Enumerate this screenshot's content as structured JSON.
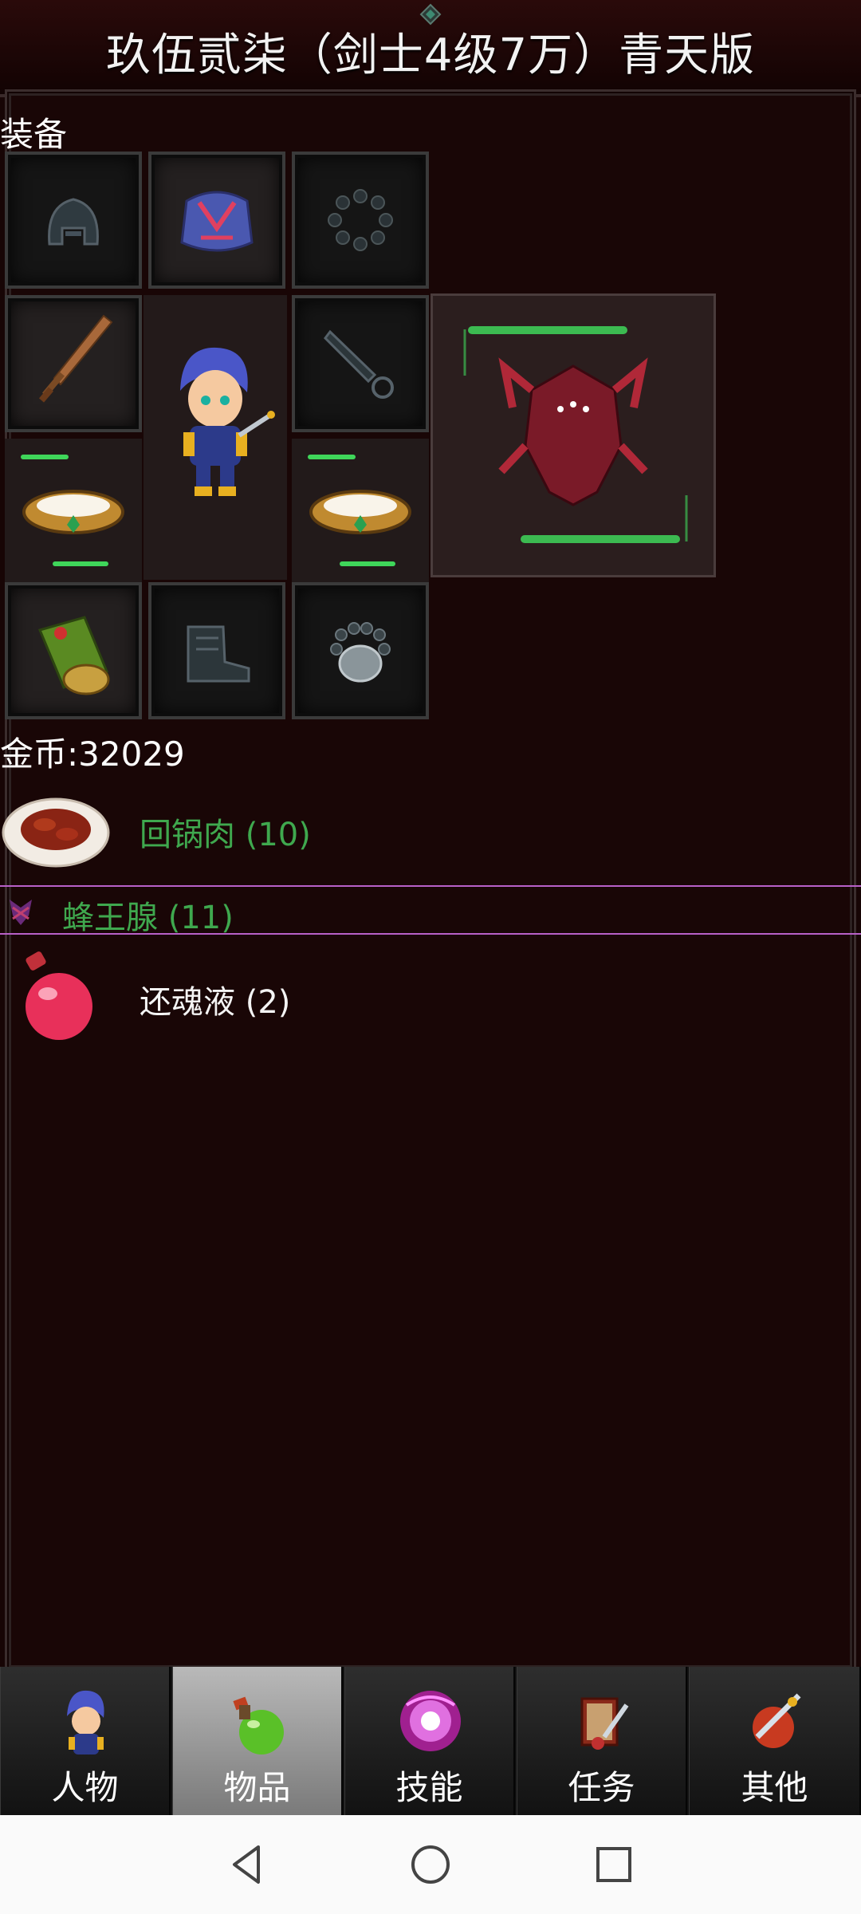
{
  "title": "玖伍贰柒（剑士4级7万）青天版",
  "equipment": {
    "label": "装备",
    "slots": {
      "helmet": "helmet-slot",
      "armor": "armor-slot",
      "necklace": "necklace-slot",
      "weapon": "weapon-slot",
      "offhand": "offhand-slot",
      "bracer": "bracer-slot",
      "boots": "boots-slot",
      "amulet": "amulet-slot"
    }
  },
  "gold": "金币:32029",
  "inventory": [
    {
      "name": "回锅肉 (10)",
      "color": "#3fa84e",
      "icon": "braised-meat-icon"
    },
    {
      "name": "蜂王腺 (11)",
      "color": "#3fa84e",
      "icon": "bee-gland-icon",
      "selected": true
    },
    {
      "name": "还魂液 (2)",
      "color": "#f4f4f4",
      "icon": "potion-icon"
    }
  ],
  "tabs": [
    {
      "label": "人物",
      "icon": "character-icon"
    },
    {
      "label": "物品",
      "icon": "items-icon",
      "active": true
    },
    {
      "label": "技能",
      "icon": "skills-icon"
    },
    {
      "label": "任务",
      "icon": "quests-icon"
    },
    {
      "label": "其他",
      "icon": "other-icon"
    }
  ],
  "system_nav": [
    "back-icon",
    "home-icon",
    "recents-icon"
  ]
}
